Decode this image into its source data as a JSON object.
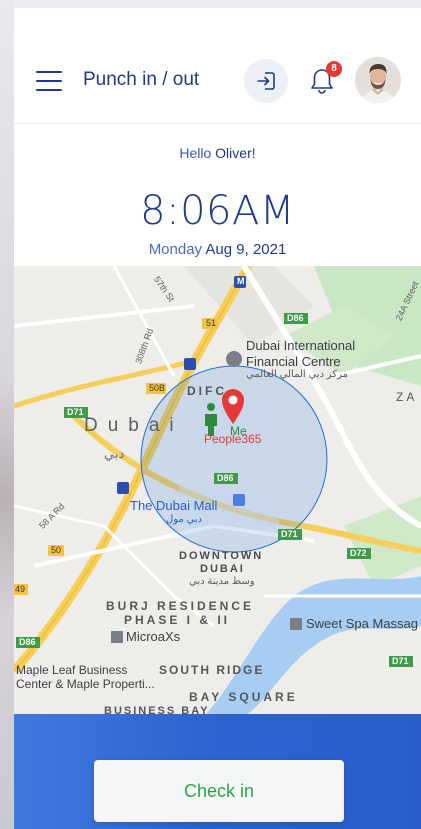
{
  "header": {
    "title": "Punch in / out",
    "notification_count": "8"
  },
  "greeting": {
    "hello": "Hello",
    "name": "Oliver!"
  },
  "clock": {
    "time": "8:06AM",
    "weekday": "Monday",
    "date": "Aug 9, 2021"
  },
  "map": {
    "labels": {
      "difc_area": "DIFC",
      "dubai": "Dubai",
      "dubai_ar": "دبي",
      "me": "Me",
      "company": "People365",
      "difc_name_1": "Dubai International",
      "difc_name_2": "Financial Centre",
      "difc_ar": "مركز دبي المالي العالمي",
      "dubai_mall": "The Dubai Mall",
      "dubai_mall_ar": "دبي مول",
      "downtown_1": "DOWNTOWN",
      "downtown_2": "DUBAI",
      "downtown_ar": "وسط مدينة دبي",
      "burj_1": "BURJ RESIDENCE",
      "burj_2": "PHASE I & II",
      "microaxs": "MicroaXs",
      "sweet_spa": "Sweet Spa Massag",
      "maple_1": "Maple Leaf Business",
      "maple_2": "Center & Maple Properti...",
      "south_ridge": "SOUTH RIDGE",
      "bay_square": "BAY SQUARE",
      "business_bay": "BUSINESS BAY",
      "za": "ZA",
      "street_57": "57th St",
      "rd_308": "308th Rd",
      "rd_58a": "58 A Rd",
      "st_24a": "24A Street",
      "d71_a": "D71",
      "d71_b": "D71",
      "d71_c": "D71",
      "d71_d": "D71",
      "d72": "D72",
      "d86_a": "D86",
      "d86_b": "D86",
      "d86_c": "D86",
      "r51": "51",
      "r50": "50",
      "r50b": "50B",
      "r49": "49",
      "metro": "M"
    },
    "colors": {
      "road_yellow": "#f6cf5a",
      "park_green": "#c8e6c1",
      "water": "#a7cdf2",
      "geofence": "#1e6fd9",
      "pin": "#e53935",
      "person": "#2e8b3e"
    }
  },
  "actions": {
    "check_in": "Check in"
  },
  "colors": {
    "brand": "#1d3b8b",
    "bottom_bar": "#2c63cf",
    "check_in_text": "#27a844"
  }
}
